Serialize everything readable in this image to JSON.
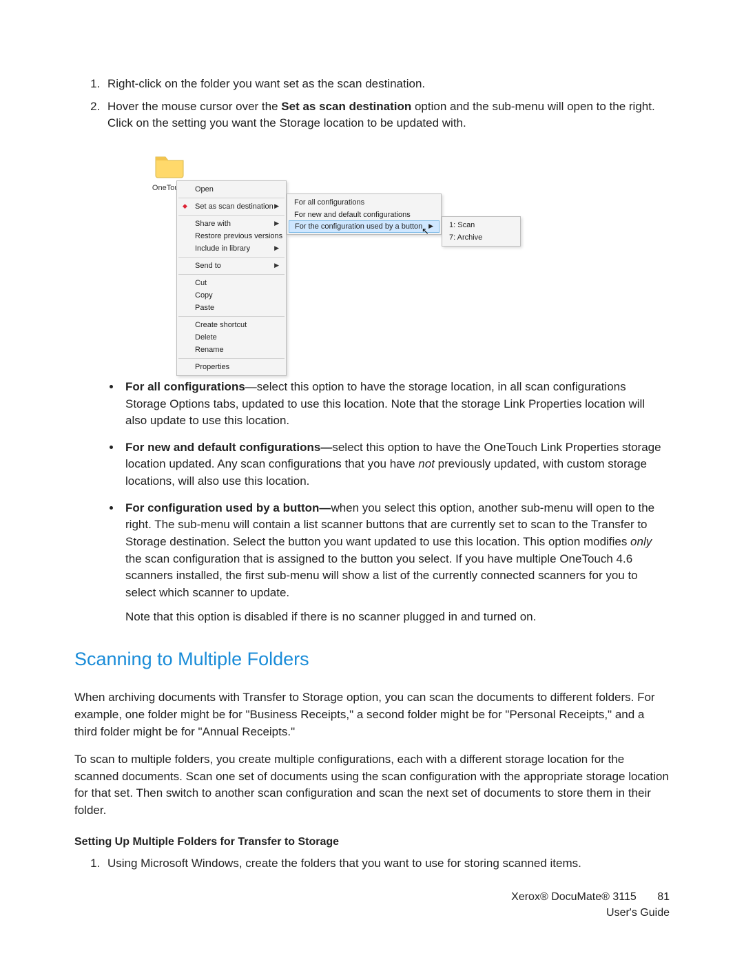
{
  "steps": [
    {
      "n": "1",
      "text": "Right-click on the folder you want set as the scan destination."
    },
    {
      "n": "2",
      "pre": "Hover the mouse cursor over the ",
      "bold": "Set as scan destination",
      "post": " option and the sub-menu will open to the right. Click on the setting you want the Storage location to be updated with."
    }
  ],
  "screenshot": {
    "folder_label": "OneTouch",
    "ctx": {
      "open": "Open",
      "set_dest": "Set as scan destination",
      "share_with": "Share with",
      "restore": "Restore previous versions",
      "include_lib": "Include in library",
      "send_to": "Send to",
      "cut": "Cut",
      "copy": "Copy",
      "paste": "Paste",
      "shortcut": "Create shortcut",
      "delete": "Delete",
      "rename": "Rename",
      "properties": "Properties"
    },
    "sub1": {
      "all": "For all configurations",
      "new_default": "For new and default configurations",
      "by_button": "For the configuration used by a button"
    },
    "sub2": {
      "scan": "1: Scan",
      "archive": "7: Archive"
    }
  },
  "bullets": {
    "b1": {
      "bold": "For all configurations",
      "text": "—select this option to have the storage location, in all scan configurations Storage Options tabs, updated to use this location. Note that the storage Link Properties location will also update to use this location."
    },
    "b2": {
      "bold": "For new and default configurations—",
      "pre": "select this option to have the OneTouch Link Properties storage location updated. Any scan configurations that you have ",
      "italic": "not",
      "post": " previously updated, with custom storage locations, will also use this location."
    },
    "b3": {
      "bold": "For configuration used by a button—",
      "pre": "when you select this option, another sub-menu will open to the right. The sub-menu will contain a list scanner buttons that are currently set to scan to the Transfer to Storage destination. Select the button you want updated to use this location. This option modifies ",
      "italic": "only",
      "post": " the scan configuration that is assigned to the button you select. If you have multiple OneTouch 4.6 scanners installed, the first sub-menu will show a list of the currently connected scanners for you to select which scanner to update.",
      "note": "Note that this option is disabled if there is no scanner plugged in and turned on."
    }
  },
  "section_heading": "Scanning to Multiple Folders",
  "paras": {
    "p1": "When archiving documents with Transfer to Storage option, you can scan the documents to different folders. For example, one folder might be for \"Business Receipts,\" a second folder might be for \"Personal Receipts,\" and a third folder might be for \"Annual Receipts.\"",
    "p2": "To scan to multiple folders, you create multiple configurations, each with a different storage location for the scanned documents. Scan one set of documents using the scan configuration with the appropriate storage location for that set. Then switch to another scan configuration and scan the next set of documents to store them in their folder."
  },
  "subheading": "Setting Up Multiple Folders for Transfer to Storage",
  "steps2": [
    {
      "n": "1",
      "text": "Using Microsoft Windows, create the folders that you want to use for storing scanned items."
    }
  ],
  "footer": {
    "product": "Xerox® DocuMate® 3115",
    "guide": "User's Guide",
    "page": "81"
  }
}
